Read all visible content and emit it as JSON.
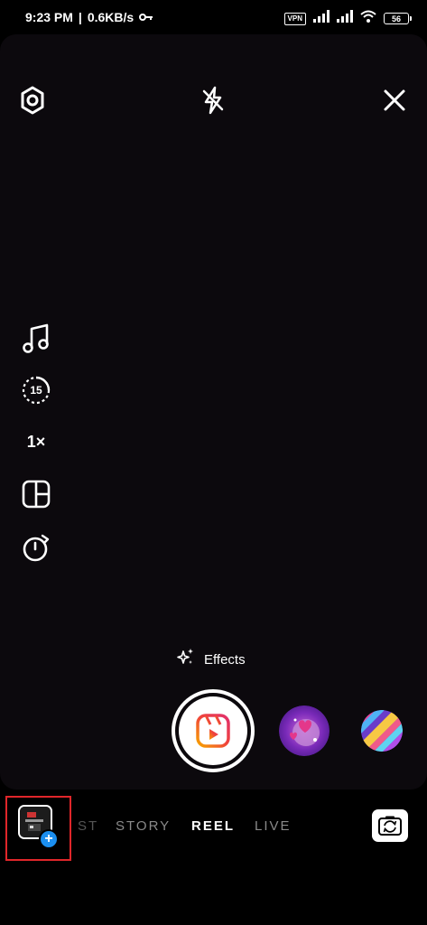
{
  "status_bar": {
    "time": "9:23 PM",
    "separator": "|",
    "network_speed": "0.6KB/s",
    "vpn_label": "VPN",
    "battery_level": "56"
  },
  "camera": {
    "top_icons": [
      "settings-icon",
      "flash-off-icon",
      "close-icon"
    ],
    "side_tools": {
      "music_icon": "music-icon",
      "length_label": "15",
      "speed_label": "1×",
      "layout_icon": "layout-icon",
      "timer_icon": "timer-icon"
    },
    "effects_label": "Effects"
  },
  "modes": {
    "partial_left": "ST",
    "story": "STORY",
    "reel": "REEL",
    "live": "LIVE",
    "active": "REEL"
  },
  "gallery": {
    "plus_symbol": "+"
  },
  "colors": {
    "accent_blue": "#1b8ff0",
    "highlight_red": "#e0262a",
    "reel_gradient_start": "#f7a400",
    "reel_gradient_end": "#e1306c"
  }
}
